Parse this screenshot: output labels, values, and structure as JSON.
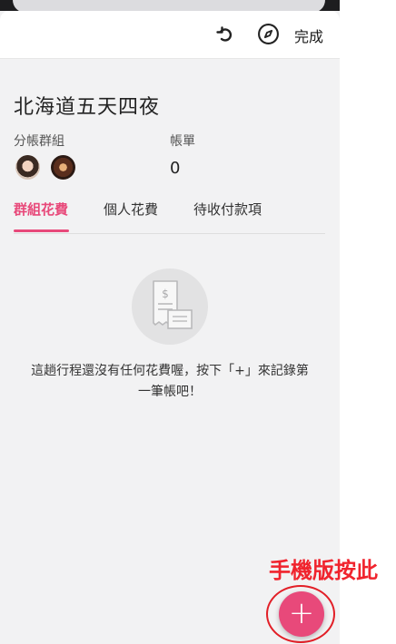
{
  "header": {
    "reload_icon": "reload-icon",
    "compass_icon": "compass-icon",
    "done_label": "完成"
  },
  "trip": {
    "title": "北海道五天四夜",
    "group_label": "分帳群組",
    "bill_label": "帳單",
    "bill_count": "0"
  },
  "tabs": [
    {
      "label": "群組花費",
      "active": true
    },
    {
      "label": "個人花費",
      "active": false
    },
    {
      "label": "待收付款項",
      "active": false
    }
  ],
  "empty_state": {
    "icon": "receipt-icon",
    "line1": "這趟行程還沒有任何花費喔，按下「+」來記錄第",
    "line2": "一筆帳吧！"
  },
  "annotation": {
    "text": "手機版按此"
  },
  "fab": {
    "label": "+"
  },
  "colors": {
    "accent": "#e8497a",
    "annotation": "#f0232d"
  }
}
